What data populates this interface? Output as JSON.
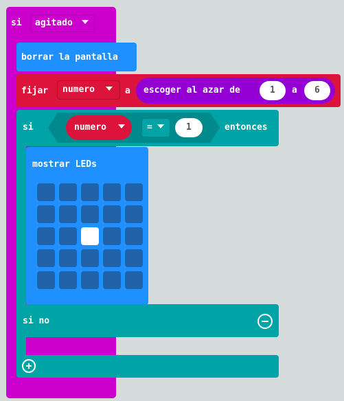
{
  "colors": {
    "event_block": "#cc00cc",
    "basic_block": "#1e90ff",
    "variable_block": "#dc143c",
    "math_block": "#9400d3",
    "logic_block": "#00a4a6",
    "workspace": "#ecf0f1"
  },
  "event_block": {
    "keyword": "si",
    "trigger": "agitado"
  },
  "clear_block": {
    "label": "borrar la pantalla"
  },
  "set_block": {
    "keyword": "fijar",
    "variable": "numero",
    "to_label": "a",
    "random": {
      "label": "escoger al azar de",
      "from": "1",
      "to_label": "a",
      "to": "6"
    }
  },
  "if_block": {
    "keyword": "si",
    "condition": {
      "variable": "numero",
      "operator": "=",
      "value": "1"
    },
    "then_label": "entonces",
    "else_label": "si no",
    "remove_icon": "minus-circle-icon",
    "add_icon": "plus-circle-icon"
  },
  "show_leds_block": {
    "label": "mostrar LEDs",
    "leds": [
      [
        0,
        0,
        0,
        0,
        0
      ],
      [
        0,
        0,
        0,
        0,
        0
      ],
      [
        0,
        0,
        1,
        0,
        0
      ],
      [
        0,
        0,
        0,
        0,
        0
      ],
      [
        0,
        0,
        0,
        0,
        0
      ]
    ]
  }
}
